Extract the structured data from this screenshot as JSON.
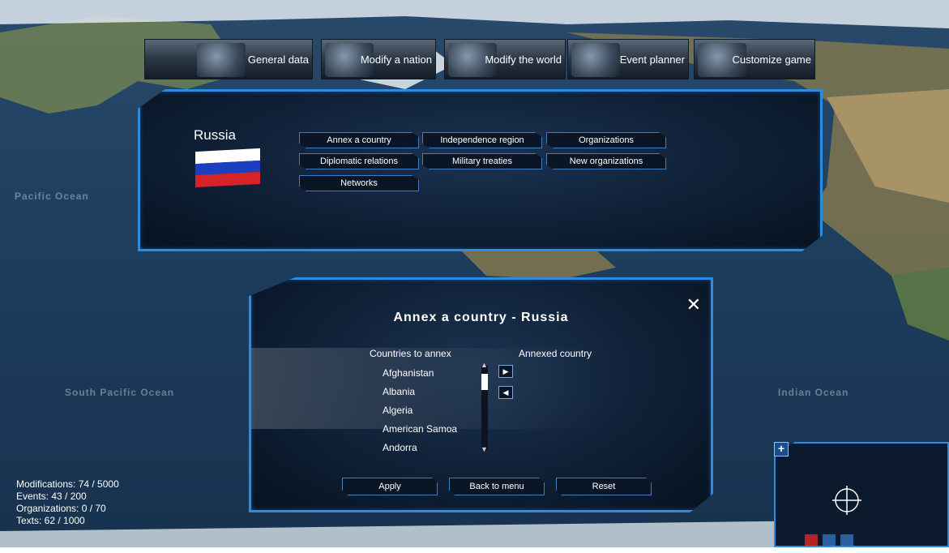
{
  "map": {
    "ocean_labels": {
      "pacific": "Pacific Ocean",
      "south_pacific": "South Pacific Ocean",
      "indian": "Indian Ocean"
    }
  },
  "tabs": [
    {
      "label": "General data"
    },
    {
      "label": "Modify a nation"
    },
    {
      "label": "Modify the world"
    },
    {
      "label": "Event planner"
    },
    {
      "label": "Customize game"
    }
  ],
  "nation": {
    "name": "Russia",
    "flag_colors": [
      "#ffffff",
      "#1c3fbf",
      "#d4242a"
    ]
  },
  "nation_actions": [
    {
      "label": "Annex a country"
    },
    {
      "label": "Independence region"
    },
    {
      "label": "Organizations"
    },
    {
      "label": "Diplomatic relations"
    },
    {
      "label": "Military treaties"
    },
    {
      "label": "New organizations"
    },
    {
      "label": "Networks"
    }
  ],
  "dialog": {
    "title": "Annex a country - Russia",
    "close_icon": "close-icon",
    "left_header": "Countries to annex",
    "right_header": "Annexed country",
    "countries": [
      "Afghanistan",
      "Albania",
      "Algeria",
      "American Samoa",
      "Andorra"
    ],
    "annexed": [],
    "apply_label": "Apply",
    "back_label": "Back to menu",
    "reset_label": "Reset"
  },
  "stats": {
    "modifications": "Modifications: 74 / 5000",
    "events": "Events: 43 / 200",
    "organizations": "Organizations: 0 / 70",
    "texts": "Texts: 62 / 1000"
  },
  "colors": {
    "accent": "#2d8be0",
    "panel_bg": "#0c1b2f"
  }
}
